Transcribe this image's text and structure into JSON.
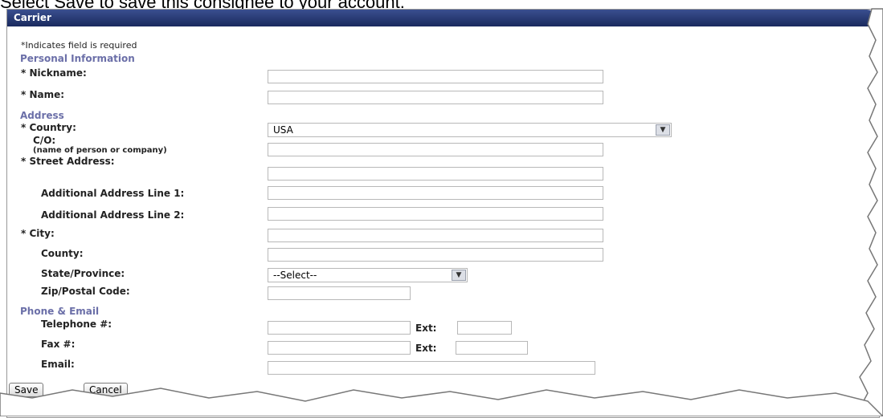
{
  "caption": "Select Save to save this consignee to your account.",
  "panel_title": "Carrier",
  "required_note": "*Indicates field is required",
  "sections": {
    "personal": "Personal Information",
    "address": "Address",
    "phone_email": "Phone & Email"
  },
  "labels": {
    "nickname": "Nickname:",
    "name": "Name:",
    "country": "Country:",
    "co": "C/O:",
    "co_sub": "(name of person or company)",
    "street": "Street Address:",
    "addr1": "Additional Address Line 1:",
    "addr2": "Additional Address Line 2:",
    "city": "City:",
    "county": "County:",
    "state": "State/Province:",
    "zip": "Zip/Postal Code:",
    "telephone": "Telephone #:",
    "fax": "Fax #:",
    "email": "Email:",
    "ext": "Ext:"
  },
  "required_marker": "*",
  "country_value": "USA",
  "state_value": "--Select--",
  "buttons": {
    "save": "Save",
    "cancel": "Cancel"
  }
}
